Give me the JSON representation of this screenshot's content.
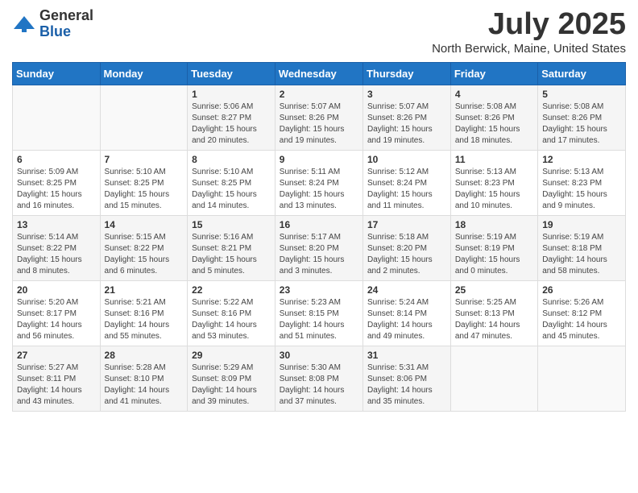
{
  "header": {
    "logo_general": "General",
    "logo_blue": "Blue",
    "title": "July 2025",
    "subtitle": "North Berwick, Maine, United States"
  },
  "days_of_week": [
    "Sunday",
    "Monday",
    "Tuesday",
    "Wednesday",
    "Thursday",
    "Friday",
    "Saturday"
  ],
  "weeks": [
    [
      {
        "day": "",
        "info": ""
      },
      {
        "day": "",
        "info": ""
      },
      {
        "day": "1",
        "info": "Sunrise: 5:06 AM\nSunset: 8:27 PM\nDaylight: 15 hours and 20 minutes."
      },
      {
        "day": "2",
        "info": "Sunrise: 5:07 AM\nSunset: 8:26 PM\nDaylight: 15 hours and 19 minutes."
      },
      {
        "day": "3",
        "info": "Sunrise: 5:07 AM\nSunset: 8:26 PM\nDaylight: 15 hours and 19 minutes."
      },
      {
        "day": "4",
        "info": "Sunrise: 5:08 AM\nSunset: 8:26 PM\nDaylight: 15 hours and 18 minutes."
      },
      {
        "day": "5",
        "info": "Sunrise: 5:08 AM\nSunset: 8:26 PM\nDaylight: 15 hours and 17 minutes."
      }
    ],
    [
      {
        "day": "6",
        "info": "Sunrise: 5:09 AM\nSunset: 8:25 PM\nDaylight: 15 hours and 16 minutes."
      },
      {
        "day": "7",
        "info": "Sunrise: 5:10 AM\nSunset: 8:25 PM\nDaylight: 15 hours and 15 minutes."
      },
      {
        "day": "8",
        "info": "Sunrise: 5:10 AM\nSunset: 8:25 PM\nDaylight: 15 hours and 14 minutes."
      },
      {
        "day": "9",
        "info": "Sunrise: 5:11 AM\nSunset: 8:24 PM\nDaylight: 15 hours and 13 minutes."
      },
      {
        "day": "10",
        "info": "Sunrise: 5:12 AM\nSunset: 8:24 PM\nDaylight: 15 hours and 11 minutes."
      },
      {
        "day": "11",
        "info": "Sunrise: 5:13 AM\nSunset: 8:23 PM\nDaylight: 15 hours and 10 minutes."
      },
      {
        "day": "12",
        "info": "Sunrise: 5:13 AM\nSunset: 8:23 PM\nDaylight: 15 hours and 9 minutes."
      }
    ],
    [
      {
        "day": "13",
        "info": "Sunrise: 5:14 AM\nSunset: 8:22 PM\nDaylight: 15 hours and 8 minutes."
      },
      {
        "day": "14",
        "info": "Sunrise: 5:15 AM\nSunset: 8:22 PM\nDaylight: 15 hours and 6 minutes."
      },
      {
        "day": "15",
        "info": "Sunrise: 5:16 AM\nSunset: 8:21 PM\nDaylight: 15 hours and 5 minutes."
      },
      {
        "day": "16",
        "info": "Sunrise: 5:17 AM\nSunset: 8:20 PM\nDaylight: 15 hours and 3 minutes."
      },
      {
        "day": "17",
        "info": "Sunrise: 5:18 AM\nSunset: 8:20 PM\nDaylight: 15 hours and 2 minutes."
      },
      {
        "day": "18",
        "info": "Sunrise: 5:19 AM\nSunset: 8:19 PM\nDaylight: 15 hours and 0 minutes."
      },
      {
        "day": "19",
        "info": "Sunrise: 5:19 AM\nSunset: 8:18 PM\nDaylight: 14 hours and 58 minutes."
      }
    ],
    [
      {
        "day": "20",
        "info": "Sunrise: 5:20 AM\nSunset: 8:17 PM\nDaylight: 14 hours and 56 minutes."
      },
      {
        "day": "21",
        "info": "Sunrise: 5:21 AM\nSunset: 8:16 PM\nDaylight: 14 hours and 55 minutes."
      },
      {
        "day": "22",
        "info": "Sunrise: 5:22 AM\nSunset: 8:16 PM\nDaylight: 14 hours and 53 minutes."
      },
      {
        "day": "23",
        "info": "Sunrise: 5:23 AM\nSunset: 8:15 PM\nDaylight: 14 hours and 51 minutes."
      },
      {
        "day": "24",
        "info": "Sunrise: 5:24 AM\nSunset: 8:14 PM\nDaylight: 14 hours and 49 minutes."
      },
      {
        "day": "25",
        "info": "Sunrise: 5:25 AM\nSunset: 8:13 PM\nDaylight: 14 hours and 47 minutes."
      },
      {
        "day": "26",
        "info": "Sunrise: 5:26 AM\nSunset: 8:12 PM\nDaylight: 14 hours and 45 minutes."
      }
    ],
    [
      {
        "day": "27",
        "info": "Sunrise: 5:27 AM\nSunset: 8:11 PM\nDaylight: 14 hours and 43 minutes."
      },
      {
        "day": "28",
        "info": "Sunrise: 5:28 AM\nSunset: 8:10 PM\nDaylight: 14 hours and 41 minutes."
      },
      {
        "day": "29",
        "info": "Sunrise: 5:29 AM\nSunset: 8:09 PM\nDaylight: 14 hours and 39 minutes."
      },
      {
        "day": "30",
        "info": "Sunrise: 5:30 AM\nSunset: 8:08 PM\nDaylight: 14 hours and 37 minutes."
      },
      {
        "day": "31",
        "info": "Sunrise: 5:31 AM\nSunset: 8:06 PM\nDaylight: 14 hours and 35 minutes."
      },
      {
        "day": "",
        "info": ""
      },
      {
        "day": "",
        "info": ""
      }
    ]
  ]
}
